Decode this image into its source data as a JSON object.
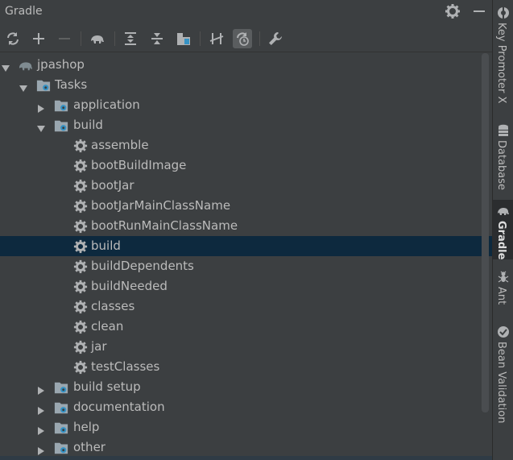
{
  "panel": {
    "title": "Gradle"
  },
  "toolbar": {
    "buttons": [
      {
        "name": "reload-icon"
      },
      {
        "name": "add-icon"
      },
      {
        "name": "remove-icon"
      },
      {
        "name": "elephant-icon"
      },
      {
        "name": "expand-all-icon"
      },
      {
        "name": "collapse-all-icon"
      },
      {
        "name": "group-modules-icon"
      },
      {
        "name": "toggle-offline-icon"
      },
      {
        "name": "history-icon"
      },
      {
        "name": "wrench-icon"
      }
    ]
  },
  "tree": {
    "rows": [
      {
        "label": "jpashop",
        "level": 0,
        "state": "expanded",
        "icon": "gradle-project-icon"
      },
      {
        "label": "Tasks",
        "level": 1,
        "state": "expanded",
        "icon": "task-folder-icon"
      },
      {
        "label": "application",
        "level": 2,
        "state": "collapsed",
        "icon": "task-folder-icon"
      },
      {
        "label": "build",
        "level": 2,
        "state": "expanded",
        "icon": "task-folder-icon"
      },
      {
        "label": "assemble",
        "level": 3,
        "state": "leaf",
        "icon": "gear-icon"
      },
      {
        "label": "bootBuildImage",
        "level": 3,
        "state": "leaf",
        "icon": "gear-icon"
      },
      {
        "label": "bootJar",
        "level": 3,
        "state": "leaf",
        "icon": "gear-icon"
      },
      {
        "label": "bootJarMainClassName",
        "level": 3,
        "state": "leaf",
        "icon": "gear-icon"
      },
      {
        "label": "bootRunMainClassName",
        "level": 3,
        "state": "leaf",
        "icon": "gear-icon"
      },
      {
        "label": "build",
        "level": 3,
        "state": "leaf",
        "icon": "gear-icon",
        "selected": true
      },
      {
        "label": "buildDependents",
        "level": 3,
        "state": "leaf",
        "icon": "gear-icon"
      },
      {
        "label": "buildNeeded",
        "level": 3,
        "state": "leaf",
        "icon": "gear-icon"
      },
      {
        "label": "classes",
        "level": 3,
        "state": "leaf",
        "icon": "gear-icon"
      },
      {
        "label": "clean",
        "level": 3,
        "state": "leaf",
        "icon": "gear-icon"
      },
      {
        "label": "jar",
        "level": 3,
        "state": "leaf",
        "icon": "gear-icon"
      },
      {
        "label": "testClasses",
        "level": 3,
        "state": "leaf",
        "icon": "gear-icon"
      },
      {
        "label": "build setup",
        "level": 2,
        "state": "collapsed",
        "icon": "task-folder-icon"
      },
      {
        "label": "documentation",
        "level": 2,
        "state": "collapsed",
        "icon": "task-folder-icon"
      },
      {
        "label": "help",
        "level": 2,
        "state": "collapsed",
        "icon": "task-folder-icon"
      },
      {
        "label": "other",
        "level": 2,
        "state": "collapsed",
        "icon": "task-folder-icon"
      }
    ]
  },
  "side_tabs": [
    {
      "label": "Key Promoter X",
      "icon": "key-promoter-icon"
    },
    {
      "label": "Database",
      "icon": "database-icon"
    },
    {
      "label": "Gradle",
      "icon": "gradle-elephant-icon",
      "active": true
    },
    {
      "label": "Ant",
      "icon": "ant-icon"
    },
    {
      "label": "Bean Validation",
      "icon": "bean-validation-icon"
    }
  ],
  "colors": {
    "background": "#3c3f41",
    "selection": "#0d293e",
    "text": "#bbbbbb",
    "icon_blue": "#3592c4"
  }
}
